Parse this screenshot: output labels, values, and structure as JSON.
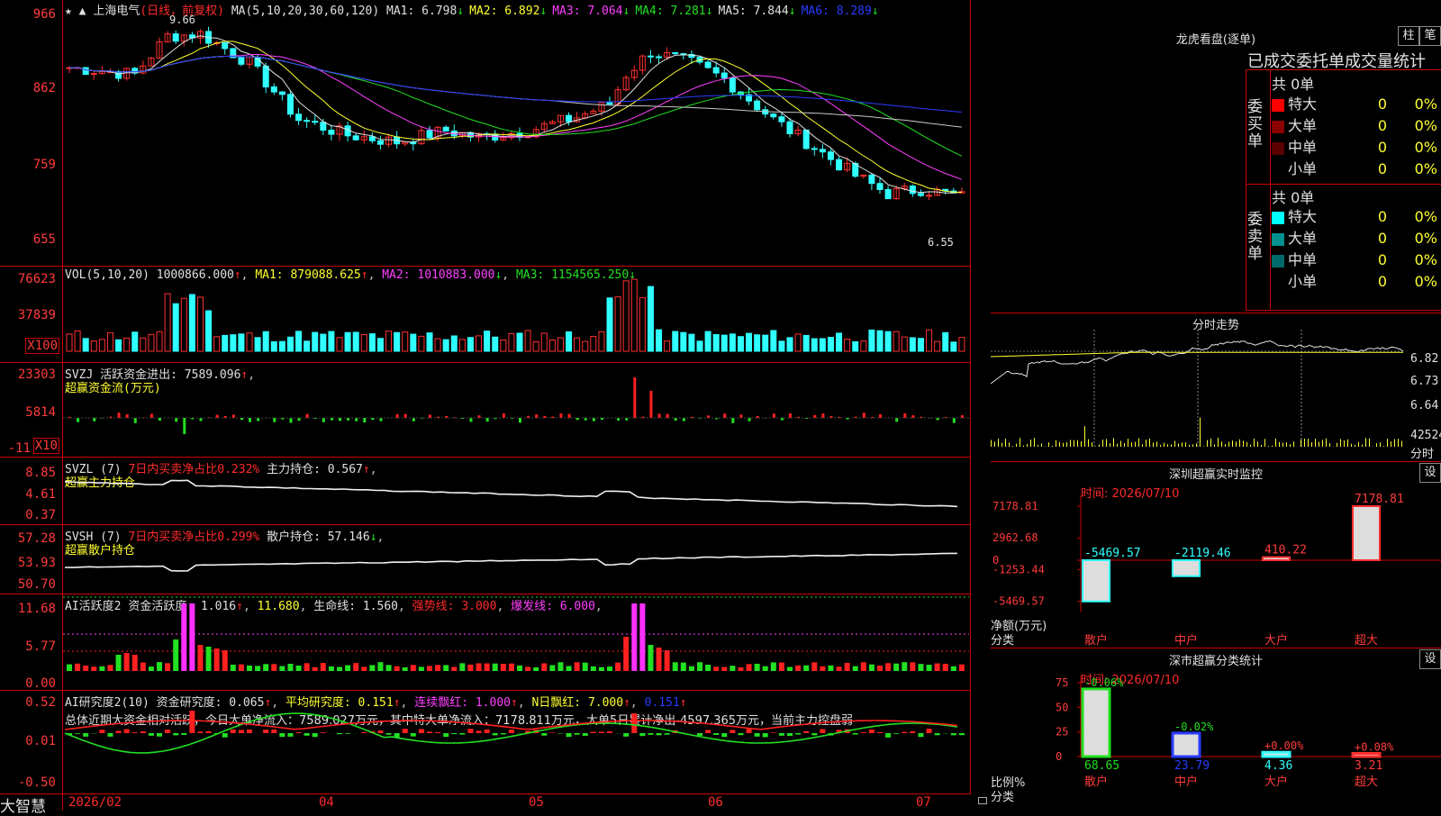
{
  "main": {
    "stock_name": "上海电气",
    "period": "(日线，前复权)",
    "ma_label": "MA(5,10,20,30,60,120)",
    "ma": [
      {
        "label": "MA1:",
        "value": "6.798",
        "arrow": "↓",
        "color": "#e0e0e0"
      },
      {
        "label": "MA2:",
        "value": "6.892",
        "arrow": "↓",
        "color": "#ffff30"
      },
      {
        "label": "MA3:",
        "value": "7.064",
        "arrow": "↓",
        "color": "#ff40ff"
      },
      {
        "label": "MA4:",
        "value": "7.281",
        "arrow": "↓",
        "color": "#22e022"
      },
      {
        "label": "MA5:",
        "value": "7.844",
        "arrow": "↓",
        "color": "#e0e0e0"
      },
      {
        "label": "MA6:",
        "value": "8.289",
        "arrow": "↓",
        "color": "#2a3cff"
      }
    ],
    "y_ticks": [
      "966",
      "862",
      "759",
      "655"
    ],
    "high_label": "9.66",
    "low_label": "6.55"
  },
  "vol": {
    "label": "VOL(5,10,20)",
    "value": "1000866.000",
    "ma1": "879088.625",
    "ma2": "1010883.000",
    "ma3": "1154565.250",
    "ticks": [
      "76623",
      "37839"
    ],
    "unit": "X100"
  },
  "svzj": {
    "label": "SVZJ",
    "desc": "活跃资金进出: 7589.096",
    "sub": "超赢资金流(万元)",
    "ticks": [
      "23303",
      "5814",
      "-11"
    ],
    "unit": "X10"
  },
  "svzl": {
    "label": "SVZL (7)",
    "desc": "7日内买卖净占比0.232%",
    "hold": "主力持仓: 0.567",
    "sub": "超赢主力持仓",
    "ticks": [
      "8.85",
      "4.61",
      "0.37"
    ]
  },
  "svsh": {
    "label": "SVSH (7)",
    "desc": "7日内买卖净占比0.299%",
    "hold": "散户持仓: 57.146",
    "sub": "超赢散户持仓",
    "ticks": [
      "57.28",
      "53.93",
      "50.70"
    ]
  },
  "ai1": {
    "label": "AI活跃度2",
    "a": "资金活跃度: 1.016",
    "b": "11.680",
    "c": "生命线: 1.560",
    "d": "强势线: 3.000",
    "e": "爆发线: 6.000",
    "ticks": [
      "11.68",
      "5.77",
      "0.00"
    ]
  },
  "ai2": {
    "label": "AI研究度2(10)",
    "a": "资金研究度: 0.065",
    "b": "平均研究度: 0.151",
    "c": "连续飘红: 1.000",
    "d": "N日飘红: 7.000",
    "e": "0.151",
    "summary": "总体近期大资金相对活跃，今日大单净流入：7589.027万元，其中特大单净流入：7178.811万元，大单5日累计净出-4597.365万元，当前主力控盘弱",
    "ticks": [
      "0.52",
      "0.01",
      "-0.50"
    ]
  },
  "footer": {
    "brand": "大智慧",
    "dates": [
      "2026/02",
      "04",
      "05",
      "06",
      "07"
    ]
  },
  "right": {
    "dragon_title": "龙虎看盘(逐单)",
    "btn_zhu": "柱",
    "btn_bi": "笔",
    "stat_title": "已成交委托单成交量统计",
    "buy_label": "委买单",
    "sell_label": "委卖单",
    "buy_total": "共 0单",
    "sell_total": "共 0单",
    "buy_rows": [
      {
        "name": "特大",
        "n": "0",
        "p": "0%",
        "color": "#ff0000"
      },
      {
        "name": "大单",
        "n": "0",
        "p": "0%",
        "color": "#8a0000"
      },
      {
        "name": "中单",
        "n": "0",
        "p": "0%",
        "color": "#5a0000"
      },
      {
        "name": "小单",
        "n": "0",
        "p": "0%",
        "color": ""
      }
    ],
    "sell_rows": [
      {
        "name": "特大",
        "n": "0",
        "p": "0%",
        "color": "#00ffff"
      },
      {
        "name": "大单",
        "n": "0",
        "p": "0%",
        "color": "#009090"
      },
      {
        "name": "中单",
        "n": "0",
        "p": "0%",
        "color": "#006a6a"
      },
      {
        "name": "小单",
        "n": "0",
        "p": "0%",
        "color": ""
      }
    ],
    "intraday_title": "分时走势",
    "intraday_ticks": [
      "6.82",
      "6.73",
      "6.64"
    ],
    "intraday_vol": "42524",
    "intraday_unit": "分时",
    "monitor_title": "深圳超赢实时监控",
    "monitor_btn": "设",
    "monitor_time": "时间: 2026/07/10",
    "monitor_ticks": [
      "7178.81",
      "2962.68",
      "0",
      "-1253.44",
      "-5469.57"
    ],
    "monitor_ylabel": "净额(万元)",
    "monitor_xlabel": "分类",
    "monitor_cats": [
      "散户",
      "中户",
      "大户",
      "超大"
    ],
    "monitor_vals": [
      "-5469.57",
      "-2119.46",
      "410.22",
      "7178.81"
    ],
    "stat2_title": "深市超赢分类统计",
    "stat2_btn": "设",
    "stat2_time": "时间: 2026/07/10",
    "stat2_ticks": [
      "75",
      "50",
      "25",
      "0"
    ],
    "stat2_ylabel": "比例%",
    "stat2_xlabel": "分类",
    "stat2_cats": [
      "散户",
      "中户",
      "大户",
      "超大"
    ],
    "stat2_vals": [
      "68.65",
      "23.79",
      "4.36",
      "3.21"
    ],
    "stat2_delta": [
      "-0.06%",
      "-0.02%",
      "+0.00%",
      "+0.08%"
    ]
  }
}
